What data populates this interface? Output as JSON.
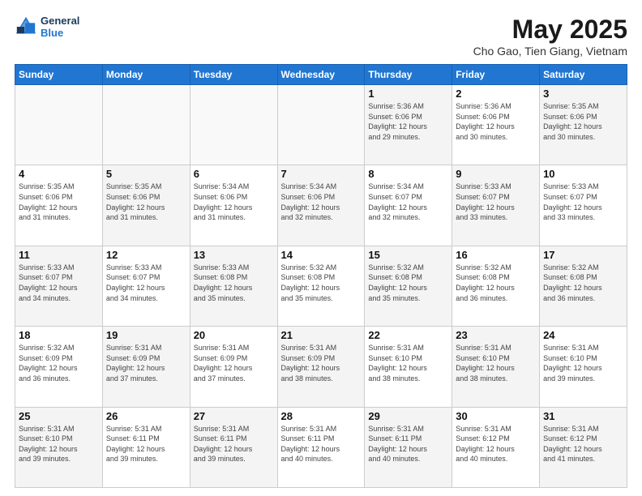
{
  "header": {
    "logo_line1": "General",
    "logo_line2": "Blue",
    "title": "May 2025",
    "subtitle": "Cho Gao, Tien Giang, Vietnam"
  },
  "weekdays": [
    "Sunday",
    "Monday",
    "Tuesday",
    "Wednesday",
    "Thursday",
    "Friday",
    "Saturday"
  ],
  "weeks": [
    [
      {
        "day": "",
        "info": "",
        "empty": true
      },
      {
        "day": "",
        "info": "",
        "empty": true
      },
      {
        "day": "",
        "info": "",
        "empty": true
      },
      {
        "day": "",
        "info": "",
        "empty": true
      },
      {
        "day": "1",
        "info": "Sunrise: 5:36 AM\nSunset: 6:06 PM\nDaylight: 12 hours\nand 29 minutes."
      },
      {
        "day": "2",
        "info": "Sunrise: 5:36 AM\nSunset: 6:06 PM\nDaylight: 12 hours\nand 30 minutes."
      },
      {
        "day": "3",
        "info": "Sunrise: 5:35 AM\nSunset: 6:06 PM\nDaylight: 12 hours\nand 30 minutes."
      }
    ],
    [
      {
        "day": "4",
        "info": "Sunrise: 5:35 AM\nSunset: 6:06 PM\nDaylight: 12 hours\nand 31 minutes."
      },
      {
        "day": "5",
        "info": "Sunrise: 5:35 AM\nSunset: 6:06 PM\nDaylight: 12 hours\nand 31 minutes."
      },
      {
        "day": "6",
        "info": "Sunrise: 5:34 AM\nSunset: 6:06 PM\nDaylight: 12 hours\nand 31 minutes."
      },
      {
        "day": "7",
        "info": "Sunrise: 5:34 AM\nSunset: 6:06 PM\nDaylight: 12 hours\nand 32 minutes."
      },
      {
        "day": "8",
        "info": "Sunrise: 5:34 AM\nSunset: 6:07 PM\nDaylight: 12 hours\nand 32 minutes."
      },
      {
        "day": "9",
        "info": "Sunrise: 5:33 AM\nSunset: 6:07 PM\nDaylight: 12 hours\nand 33 minutes."
      },
      {
        "day": "10",
        "info": "Sunrise: 5:33 AM\nSunset: 6:07 PM\nDaylight: 12 hours\nand 33 minutes."
      }
    ],
    [
      {
        "day": "11",
        "info": "Sunrise: 5:33 AM\nSunset: 6:07 PM\nDaylight: 12 hours\nand 34 minutes."
      },
      {
        "day": "12",
        "info": "Sunrise: 5:33 AM\nSunset: 6:07 PM\nDaylight: 12 hours\nand 34 minutes."
      },
      {
        "day": "13",
        "info": "Sunrise: 5:33 AM\nSunset: 6:08 PM\nDaylight: 12 hours\nand 35 minutes."
      },
      {
        "day": "14",
        "info": "Sunrise: 5:32 AM\nSunset: 6:08 PM\nDaylight: 12 hours\nand 35 minutes."
      },
      {
        "day": "15",
        "info": "Sunrise: 5:32 AM\nSunset: 6:08 PM\nDaylight: 12 hours\nand 35 minutes."
      },
      {
        "day": "16",
        "info": "Sunrise: 5:32 AM\nSunset: 6:08 PM\nDaylight: 12 hours\nand 36 minutes."
      },
      {
        "day": "17",
        "info": "Sunrise: 5:32 AM\nSunset: 6:08 PM\nDaylight: 12 hours\nand 36 minutes."
      }
    ],
    [
      {
        "day": "18",
        "info": "Sunrise: 5:32 AM\nSunset: 6:09 PM\nDaylight: 12 hours\nand 36 minutes."
      },
      {
        "day": "19",
        "info": "Sunrise: 5:31 AM\nSunset: 6:09 PM\nDaylight: 12 hours\nand 37 minutes."
      },
      {
        "day": "20",
        "info": "Sunrise: 5:31 AM\nSunset: 6:09 PM\nDaylight: 12 hours\nand 37 minutes."
      },
      {
        "day": "21",
        "info": "Sunrise: 5:31 AM\nSunset: 6:09 PM\nDaylight: 12 hours\nand 38 minutes."
      },
      {
        "day": "22",
        "info": "Sunrise: 5:31 AM\nSunset: 6:10 PM\nDaylight: 12 hours\nand 38 minutes."
      },
      {
        "day": "23",
        "info": "Sunrise: 5:31 AM\nSunset: 6:10 PM\nDaylight: 12 hours\nand 38 minutes."
      },
      {
        "day": "24",
        "info": "Sunrise: 5:31 AM\nSunset: 6:10 PM\nDaylight: 12 hours\nand 39 minutes."
      }
    ],
    [
      {
        "day": "25",
        "info": "Sunrise: 5:31 AM\nSunset: 6:10 PM\nDaylight: 12 hours\nand 39 minutes."
      },
      {
        "day": "26",
        "info": "Sunrise: 5:31 AM\nSunset: 6:11 PM\nDaylight: 12 hours\nand 39 minutes."
      },
      {
        "day": "27",
        "info": "Sunrise: 5:31 AM\nSunset: 6:11 PM\nDaylight: 12 hours\nand 39 minutes."
      },
      {
        "day": "28",
        "info": "Sunrise: 5:31 AM\nSunset: 6:11 PM\nDaylight: 12 hours\nand 40 minutes."
      },
      {
        "day": "29",
        "info": "Sunrise: 5:31 AM\nSunset: 6:11 PM\nDaylight: 12 hours\nand 40 minutes."
      },
      {
        "day": "30",
        "info": "Sunrise: 5:31 AM\nSunset: 6:12 PM\nDaylight: 12 hours\nand 40 minutes."
      },
      {
        "day": "31",
        "info": "Sunrise: 5:31 AM\nSunset: 6:12 PM\nDaylight: 12 hours\nand 41 minutes."
      }
    ]
  ]
}
